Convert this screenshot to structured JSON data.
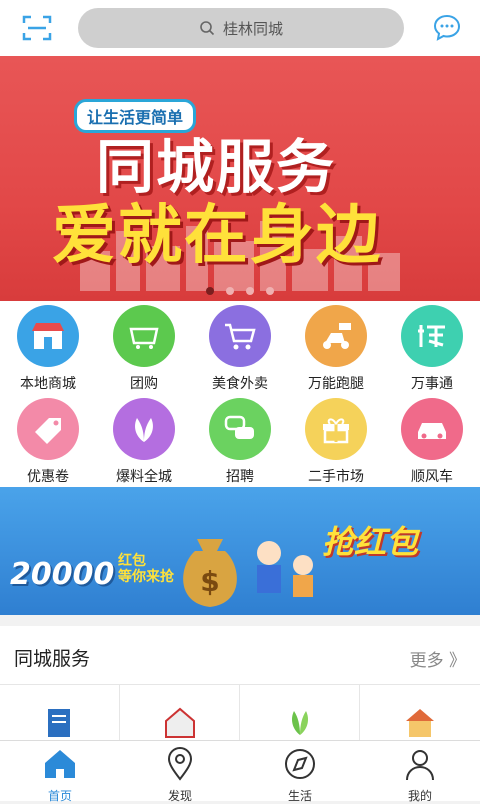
{
  "header": {
    "search_placeholder": "桂林同城"
  },
  "banner": {
    "tag": "让生活更简单",
    "title_line1": "同城服务",
    "title_line2": "爱就在身边"
  },
  "grid": [
    {
      "label": "本地商城",
      "color": "#3aa3e6"
    },
    {
      "label": "团购",
      "color": "#5cc94e"
    },
    {
      "label": "美食外卖",
      "color": "#8b6fe0"
    },
    {
      "label": "万能跑腿",
      "color": "#f0a64a"
    },
    {
      "label": "万事通",
      "color": "#3ed0b0"
    },
    {
      "label": "优惠卷",
      "color": "#f38aa8"
    },
    {
      "label": "爆料全城",
      "color": "#b46ee0"
    },
    {
      "label": "招聘",
      "color": "#6bd260"
    },
    {
      "label": "二手市场",
      "color": "#f5d25a"
    },
    {
      "label": "顺风车",
      "color": "#f06a8a"
    }
  ],
  "promo": {
    "amount": "20000",
    "sub_line1": "红包",
    "sub_line2": "等你来抢",
    "grab": "抢红包"
  },
  "services": {
    "title": "同城服务",
    "more": "更多 》"
  },
  "tabbar": [
    {
      "label": "首页",
      "active": true
    },
    {
      "label": "发现",
      "active": false
    },
    {
      "label": "生活",
      "active": false
    },
    {
      "label": "我的",
      "active": false
    }
  ]
}
